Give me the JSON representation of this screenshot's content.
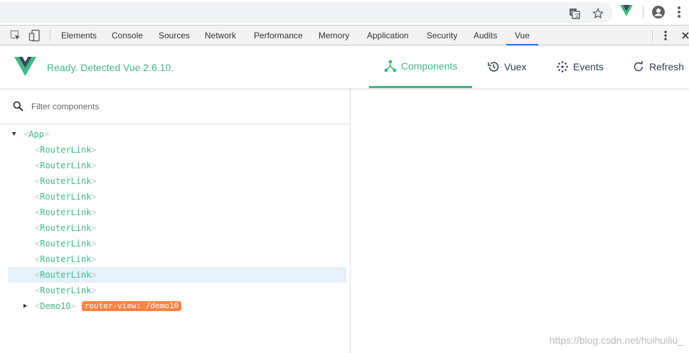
{
  "devtools": {
    "tabs": [
      "Elements",
      "Console",
      "Sources",
      "Network",
      "Performance",
      "Memory",
      "Application",
      "Security",
      "Audits",
      "Vue"
    ],
    "active_tab": "Vue"
  },
  "vue_panel": {
    "status": "Ready. Detected Vue 2.6.10.",
    "tabs": {
      "components": "Components",
      "vuex": "Vuex",
      "events": "Events",
      "refresh": "Refresh"
    },
    "active_tab": "Components",
    "filter": {
      "placeholder": "Filter components",
      "value": ""
    }
  },
  "tree": {
    "open_bracket": "<",
    "close_bracket": ">",
    "root": "App",
    "children": [
      "RouterLink",
      "RouterLink",
      "RouterLink",
      "RouterLink",
      "RouterLink",
      "RouterLink",
      "RouterLink",
      "RouterLink",
      "RouterLink",
      "RouterLink"
    ],
    "selected_index": 8,
    "last": {
      "name": "Demo10",
      "tag": "router-view: /demo10"
    }
  },
  "watermark": "https://blog.csdn.net/huihuiliu_",
  "colors": {
    "vue_green": "#42b983",
    "tag_orange": "#ff8344",
    "selected_row": "#e3f1fb"
  },
  "icons": [
    "translate-icon",
    "star-icon",
    "vue-extension-icon",
    "account-icon",
    "more-vert-icon",
    "inspect-icon",
    "device-toggle-icon",
    "components-icon",
    "history-icon",
    "events-icon",
    "refresh-icon",
    "search-icon"
  ]
}
